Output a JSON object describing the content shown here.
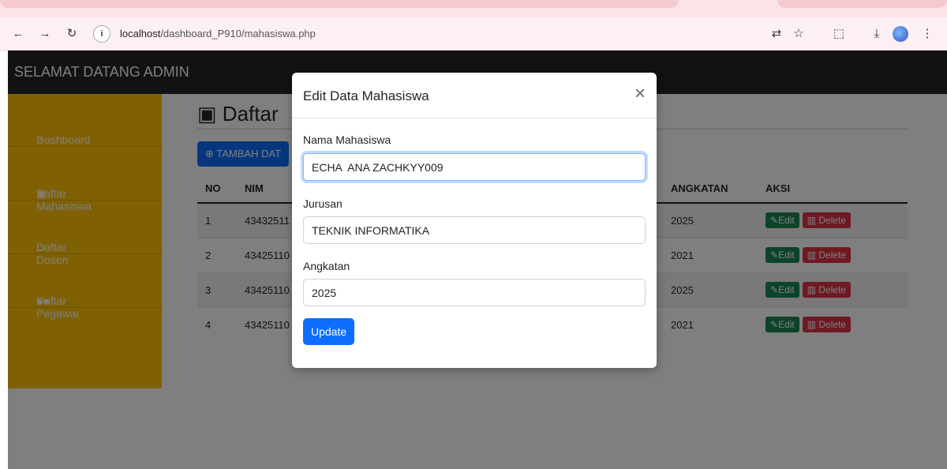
{
  "browser": {
    "url_host": "localhost",
    "url_path": "/dashboard_P910/mahasiswa.php"
  },
  "navbar": {
    "brand": "SELAMAT DATANG ADMIN"
  },
  "sidebar": {
    "items": [
      {
        "label": "Dashboard",
        "icon": "dashboard-icon"
      },
      {
        "label": "Daftar Mahasiswa",
        "icon": "graduate-icon"
      },
      {
        "label": "Daftar Dosen",
        "icon": "chalkboard-icon"
      },
      {
        "label": "Daftar Pegawai",
        "icon": "users-icon"
      }
    ]
  },
  "main": {
    "title": "Daftar",
    "add_button": "TAMBAH DAT",
    "table": {
      "headers": [
        "NO",
        "NIM",
        "ANGKATAN",
        "AKSI"
      ],
      "rows": [
        {
          "no": "1",
          "nim": "43432511",
          "angkatan": "2025"
        },
        {
          "no": "2",
          "nim": "43425110",
          "angkatan": "2021"
        },
        {
          "no": "3",
          "nim": "43425110",
          "angkatan": "2025"
        },
        {
          "no": "4",
          "nim": "43425110",
          "angkatan": "2021"
        }
      ],
      "edit_label": "Edit",
      "delete_label": "Delete"
    }
  },
  "modal": {
    "title": "Edit Data Mahasiswa",
    "fields": {
      "nama_label": "Nama Mahasiswa",
      "nama_value": "ECHA  ANA ZACHKYY009",
      "jurusan_label": "Jurusan",
      "jurusan_value": "TEKNIK INFORMATIKA",
      "angkatan_label": "Angkatan",
      "angkatan_value": "2025"
    },
    "update_button": "Update"
  },
  "colors": {
    "navbar": "#212529",
    "sidebar": "#ffc107",
    "primary": "#0d6efd",
    "success": "#198754",
    "danger": "#dc3545"
  }
}
